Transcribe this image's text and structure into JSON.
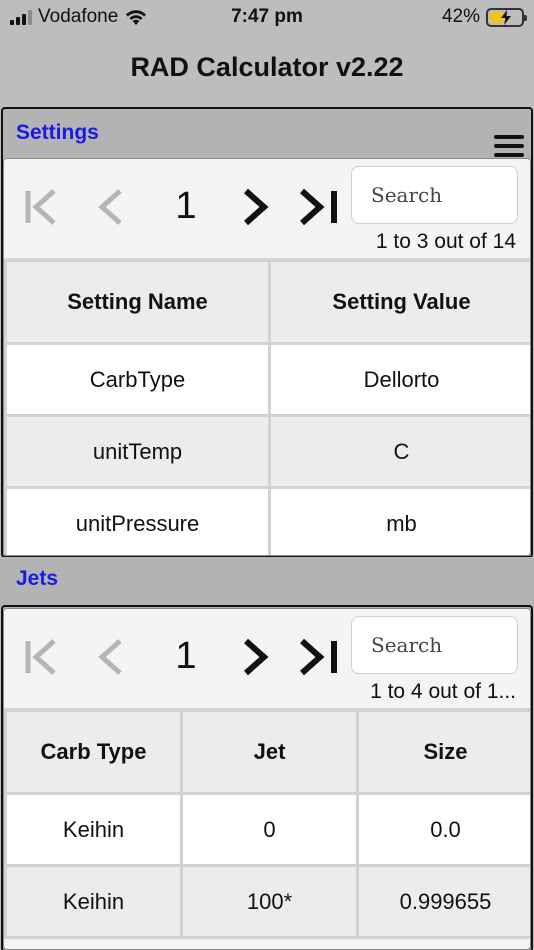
{
  "status_bar": {
    "carrier": "Vodafone",
    "time": "7:47 pm",
    "battery": "42%"
  },
  "app": {
    "title": "RAD Calculator v2.22"
  },
  "settings": {
    "title": "Settings",
    "pager": {
      "page": "1",
      "search_placeholder": "Search",
      "count": "1 to 3 out of 14"
    },
    "columns": [
      "Setting Name",
      "Setting Value"
    ],
    "rows": [
      [
        "CarbType",
        "Dellorto"
      ],
      [
        "unitTemp",
        "C"
      ],
      [
        "unitPressure",
        "mb"
      ]
    ]
  },
  "jets": {
    "title": "Jets",
    "pager": {
      "page": "1",
      "search_placeholder": "Search",
      "count": "1 to 4 out of 1..."
    },
    "columns": [
      "Carb Type",
      "Jet",
      "Size"
    ],
    "rows": [
      [
        "Keihin",
        "0",
        "0.0"
      ],
      [
        "Keihin",
        "100*",
        "0.999655"
      ]
    ]
  },
  "colors": {
    "section_title": "#1a1ae6",
    "battery_fill": "#f2c41a",
    "background": "#bdbdbd"
  }
}
